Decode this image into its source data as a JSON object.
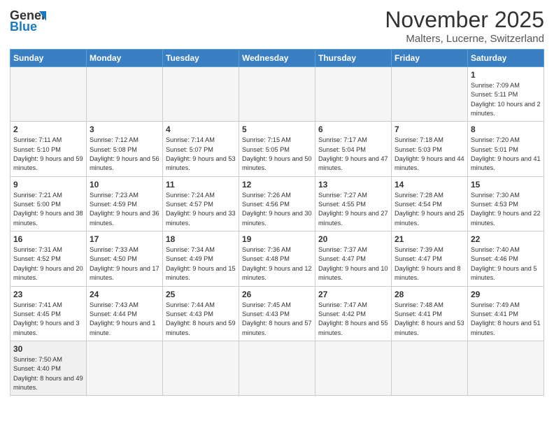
{
  "header": {
    "logo_general": "General",
    "logo_blue": "Blue",
    "month_title": "November 2025",
    "location": "Malters, Lucerne, Switzerland"
  },
  "days_of_week": [
    "Sunday",
    "Monday",
    "Tuesday",
    "Wednesday",
    "Thursday",
    "Friday",
    "Saturday"
  ],
  "weeks": [
    [
      {
        "day": "",
        "info": ""
      },
      {
        "day": "",
        "info": ""
      },
      {
        "day": "",
        "info": ""
      },
      {
        "day": "",
        "info": ""
      },
      {
        "day": "",
        "info": ""
      },
      {
        "day": "",
        "info": ""
      },
      {
        "day": "1",
        "info": "Sunrise: 7:09 AM\nSunset: 5:11 PM\nDaylight: 10 hours and 2 minutes."
      }
    ],
    [
      {
        "day": "2",
        "info": "Sunrise: 7:11 AM\nSunset: 5:10 PM\nDaylight: 9 hours and 59 minutes."
      },
      {
        "day": "3",
        "info": "Sunrise: 7:12 AM\nSunset: 5:08 PM\nDaylight: 9 hours and 56 minutes."
      },
      {
        "day": "4",
        "info": "Sunrise: 7:14 AM\nSunset: 5:07 PM\nDaylight: 9 hours and 53 minutes."
      },
      {
        "day": "5",
        "info": "Sunrise: 7:15 AM\nSunset: 5:05 PM\nDaylight: 9 hours and 50 minutes."
      },
      {
        "day": "6",
        "info": "Sunrise: 7:17 AM\nSunset: 5:04 PM\nDaylight: 9 hours and 47 minutes."
      },
      {
        "day": "7",
        "info": "Sunrise: 7:18 AM\nSunset: 5:03 PM\nDaylight: 9 hours and 44 minutes."
      },
      {
        "day": "8",
        "info": "Sunrise: 7:20 AM\nSunset: 5:01 PM\nDaylight: 9 hours and 41 minutes."
      }
    ],
    [
      {
        "day": "9",
        "info": "Sunrise: 7:21 AM\nSunset: 5:00 PM\nDaylight: 9 hours and 38 minutes."
      },
      {
        "day": "10",
        "info": "Sunrise: 7:23 AM\nSunset: 4:59 PM\nDaylight: 9 hours and 36 minutes."
      },
      {
        "day": "11",
        "info": "Sunrise: 7:24 AM\nSunset: 4:57 PM\nDaylight: 9 hours and 33 minutes."
      },
      {
        "day": "12",
        "info": "Sunrise: 7:26 AM\nSunset: 4:56 PM\nDaylight: 9 hours and 30 minutes."
      },
      {
        "day": "13",
        "info": "Sunrise: 7:27 AM\nSunset: 4:55 PM\nDaylight: 9 hours and 27 minutes."
      },
      {
        "day": "14",
        "info": "Sunrise: 7:28 AM\nSunset: 4:54 PM\nDaylight: 9 hours and 25 minutes."
      },
      {
        "day": "15",
        "info": "Sunrise: 7:30 AM\nSunset: 4:53 PM\nDaylight: 9 hours and 22 minutes."
      }
    ],
    [
      {
        "day": "16",
        "info": "Sunrise: 7:31 AM\nSunset: 4:52 PM\nDaylight: 9 hours and 20 minutes."
      },
      {
        "day": "17",
        "info": "Sunrise: 7:33 AM\nSunset: 4:50 PM\nDaylight: 9 hours and 17 minutes."
      },
      {
        "day": "18",
        "info": "Sunrise: 7:34 AM\nSunset: 4:49 PM\nDaylight: 9 hours and 15 minutes."
      },
      {
        "day": "19",
        "info": "Sunrise: 7:36 AM\nSunset: 4:48 PM\nDaylight: 9 hours and 12 minutes."
      },
      {
        "day": "20",
        "info": "Sunrise: 7:37 AM\nSunset: 4:47 PM\nDaylight: 9 hours and 10 minutes."
      },
      {
        "day": "21",
        "info": "Sunrise: 7:39 AM\nSunset: 4:47 PM\nDaylight: 9 hours and 8 minutes."
      },
      {
        "day": "22",
        "info": "Sunrise: 7:40 AM\nSunset: 4:46 PM\nDaylight: 9 hours and 5 minutes."
      }
    ],
    [
      {
        "day": "23",
        "info": "Sunrise: 7:41 AM\nSunset: 4:45 PM\nDaylight: 9 hours and 3 minutes."
      },
      {
        "day": "24",
        "info": "Sunrise: 7:43 AM\nSunset: 4:44 PM\nDaylight: 9 hours and 1 minute."
      },
      {
        "day": "25",
        "info": "Sunrise: 7:44 AM\nSunset: 4:43 PM\nDaylight: 8 hours and 59 minutes."
      },
      {
        "day": "26",
        "info": "Sunrise: 7:45 AM\nSunset: 4:43 PM\nDaylight: 8 hours and 57 minutes."
      },
      {
        "day": "27",
        "info": "Sunrise: 7:47 AM\nSunset: 4:42 PM\nDaylight: 8 hours and 55 minutes."
      },
      {
        "day": "28",
        "info": "Sunrise: 7:48 AM\nSunset: 4:41 PM\nDaylight: 8 hours and 53 minutes."
      },
      {
        "day": "29",
        "info": "Sunrise: 7:49 AM\nSunset: 4:41 PM\nDaylight: 8 hours and 51 minutes."
      }
    ],
    [
      {
        "day": "30",
        "info": "Sunrise: 7:50 AM\nSunset: 4:40 PM\nDaylight: 8 hours and 49 minutes."
      },
      {
        "day": "",
        "info": ""
      },
      {
        "day": "",
        "info": ""
      },
      {
        "day": "",
        "info": ""
      },
      {
        "day": "",
        "info": ""
      },
      {
        "day": "",
        "info": ""
      },
      {
        "day": "",
        "info": ""
      }
    ]
  ]
}
